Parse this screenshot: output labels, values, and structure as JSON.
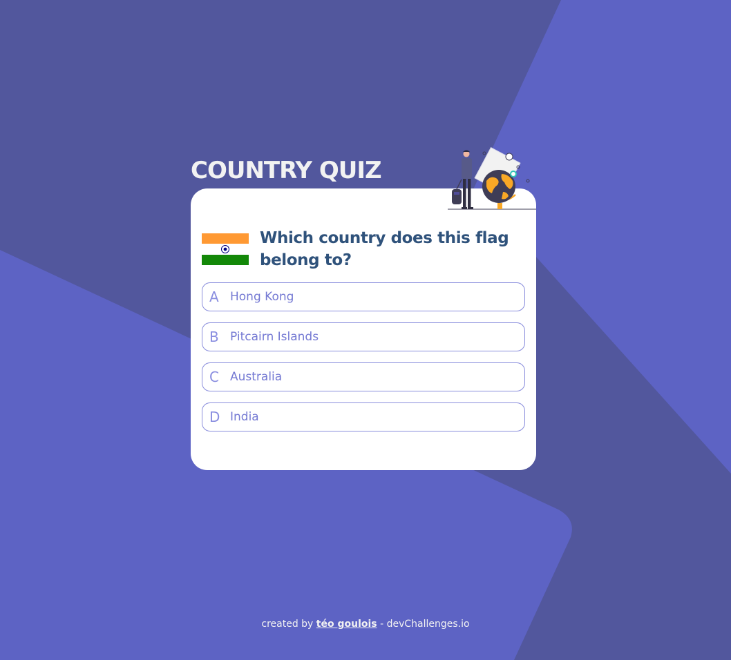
{
  "app": {
    "title": "COUNTRY QUIZ"
  },
  "quiz": {
    "flag_icon": "india-flag-icon",
    "illustration_icon": "traveler-globe-illustration",
    "question": "Which country does this flag belong to?",
    "options": [
      {
        "letter": "A",
        "text": "Hong Kong"
      },
      {
        "letter": "B",
        "text": "Pitcairn Islands"
      },
      {
        "letter": "C",
        "text": "Australia"
      },
      {
        "letter": "D",
        "text": "India"
      }
    ]
  },
  "footer": {
    "prefix": "created by",
    "author": "téo goulois",
    "separator": "-",
    "site": "devChallenges.io"
  },
  "colors": {
    "background": "#5d63c4",
    "background_dark": "#52579d",
    "card": "#ffffff",
    "question_text": "#2f527b",
    "option_text": "#7479d3",
    "option_border": "#6066d0",
    "title_text": "#f2f2f2"
  }
}
